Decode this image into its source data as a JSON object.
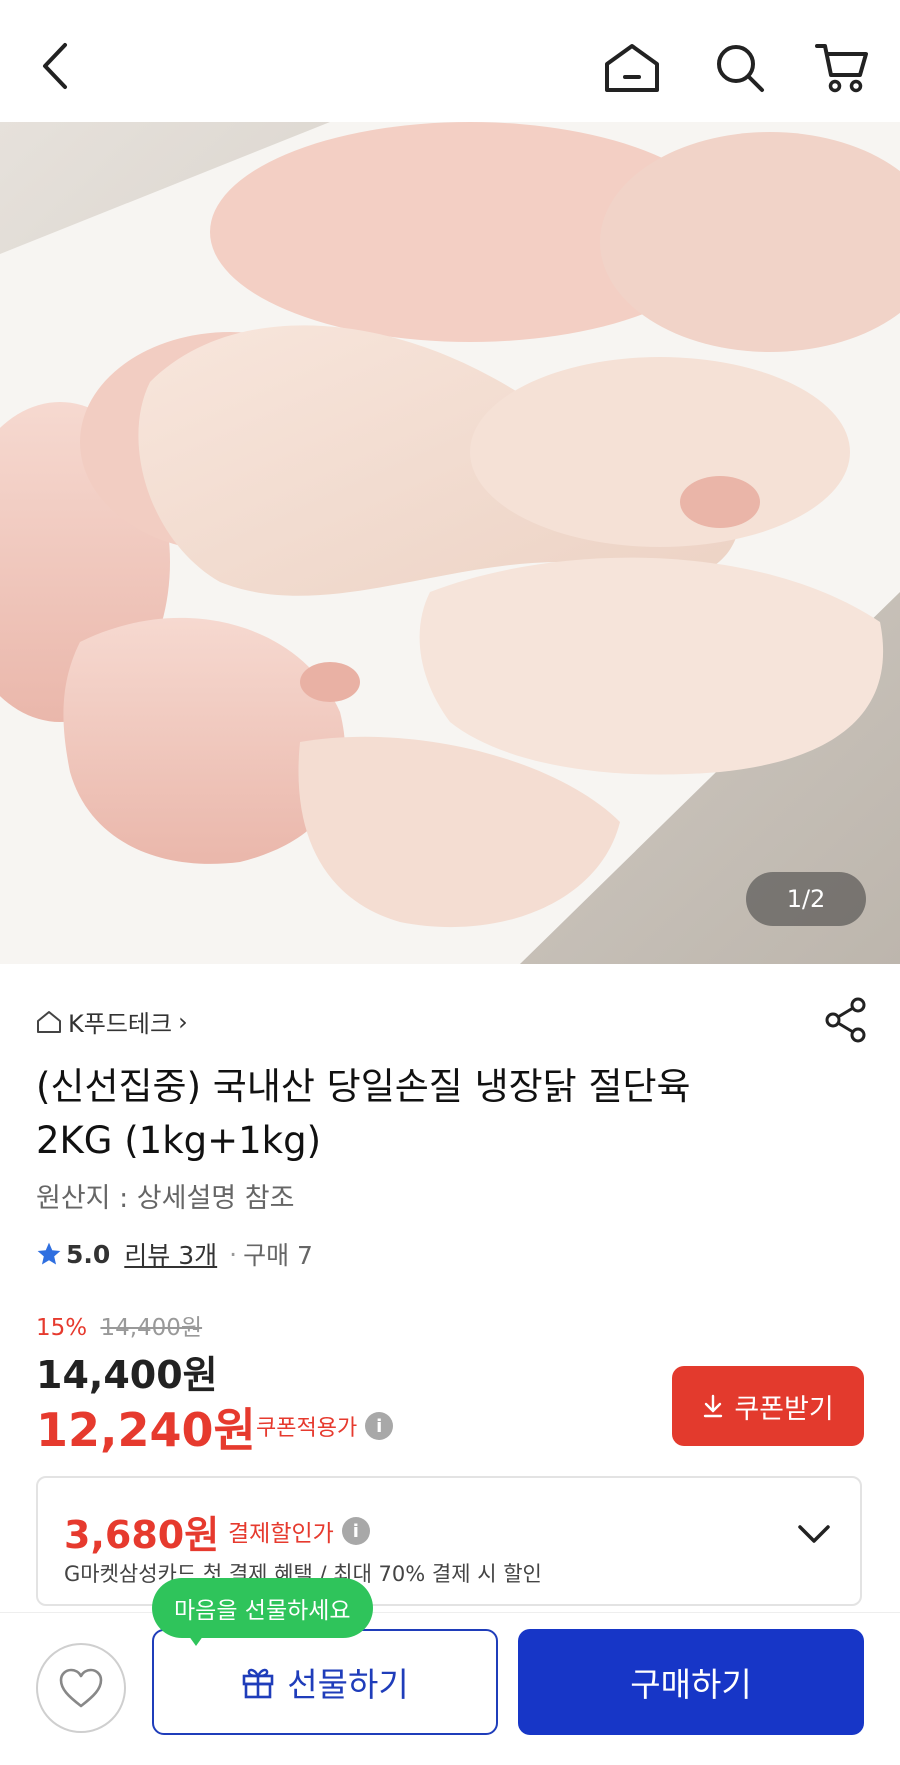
{
  "top_bar": {
    "icons": [
      "chevron-left-icon",
      "home-icon",
      "search-icon",
      "cart-icon"
    ]
  },
  "gallery": {
    "counter": "1/2"
  },
  "product": {
    "seller": "K푸드테크",
    "seller_chevron": "›",
    "title_line1": "(신선집중) 국내산 당일손질 냉장닭 절단육",
    "title_line2": "2KG (1kg+1kg)",
    "origin": "원산지 : 상세설명 참조",
    "rating_score": "5.0",
    "review_link": "리뷰 3개",
    "dot": "·",
    "sold": "구매 7"
  },
  "pricing": {
    "discount_rate": "15%",
    "original_price": "14,400원",
    "price": "14,400원",
    "coupon_price": "12,240원",
    "coupon_applicable": "쿠폰적용가",
    "coupon_button": "쿠폰받기",
    "info_glyph": "i"
  },
  "payment_discount": {
    "amount": "3,680원",
    "label": "결제할인가",
    "description": "G마켓삼성카드 첫 결제 혜택 / 최대 70% 결제 시 할인"
  },
  "bottom_bar": {
    "tooltip": "마음을 선물하세요",
    "gift_button": "선물하기",
    "buy_button": "구매하기"
  },
  "colors": {
    "accent_red": "#e63a2e",
    "brand_blue": "#1736c7",
    "tooltip_green": "#2fc45b",
    "star_blue": "#2f6fe0"
  }
}
